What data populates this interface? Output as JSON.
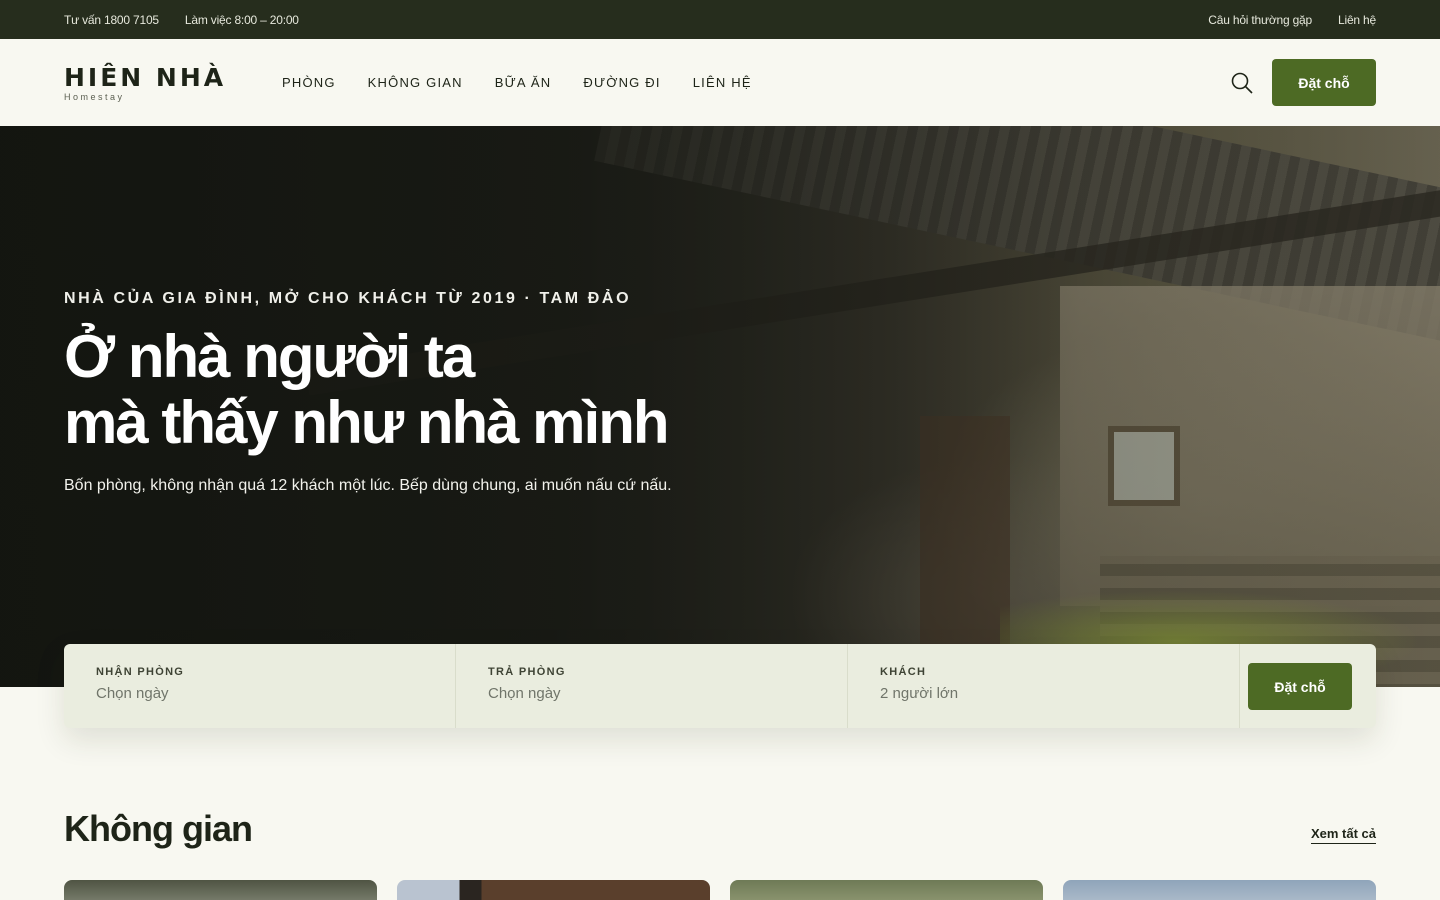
{
  "topbar": {
    "phone": "Tư vấn 1800 7105",
    "hours": "Làm việc 8:00 – 20:00",
    "faq": "Câu hỏi thường gặp",
    "contact": "Liên hệ"
  },
  "header": {
    "logo_name": "HIÊN NHÀ",
    "logo_sub": "Homestay",
    "nav": [
      "PHÒNG",
      "KHÔNG GIAN",
      "BỮA ĂN",
      "ĐƯỜNG ĐI",
      "LIÊN HỆ"
    ],
    "search_icon": "search-icon",
    "book_label": "Đặt chỗ"
  },
  "hero": {
    "eyebrow": "NHÀ CỦA GIA ĐÌNH, MỞ CHO KHÁCH TỪ 2019 · TAM ĐẢO",
    "headline_line1": "Ở nhà người ta",
    "headline_line2": "mà thấy như nhà mình",
    "subtext": "Bốn phòng, không nhận quá 12 khách một lúc. Bếp dùng chung, ai muốn nấu cứ nấu."
  },
  "booking": {
    "checkin_label": "NHẬN PHÒNG",
    "checkin_value": "Chọn ngày",
    "checkout_label": "TRẢ PHÒNG",
    "checkout_value": "Chọn ngày",
    "guests_label": "KHÁCH",
    "guests_value": "2 người lớn",
    "submit_label": "Đặt chỗ"
  },
  "section": {
    "title": "Không gian",
    "see_all": "Xem tất cả"
  },
  "colors": {
    "accent": "#4d6a24",
    "topbar_bg": "#262d1d",
    "page_bg": "#f8f8f1",
    "booking_bg": "#eaeddf"
  }
}
